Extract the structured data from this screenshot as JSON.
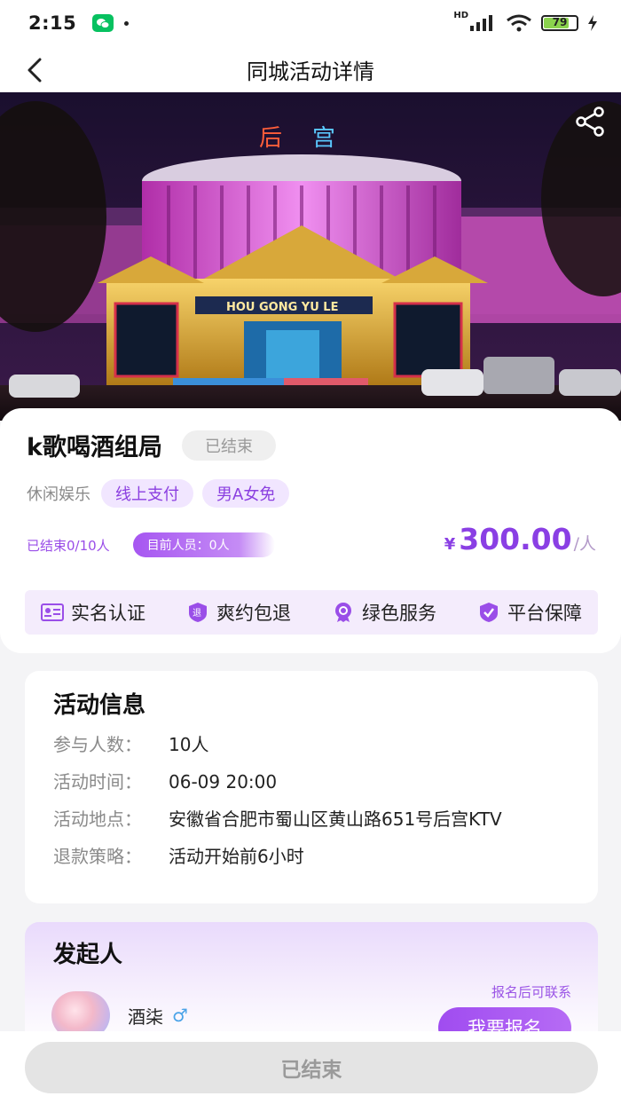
{
  "status_bar": {
    "time": "2:15",
    "battery": "79",
    "battery_level": 0.79,
    "network": "HD"
  },
  "nav": {
    "title": "同城活动详情"
  },
  "hero": {
    "sign_text": "后 宫",
    "banner_text": "HOU GONG YU LE"
  },
  "activity": {
    "title": "k歌喝酒组局",
    "status": "已结束",
    "category": "休闲娱乐",
    "tags": [
      "线上支付",
      "男A女免"
    ],
    "ended_count": "已结束0/10人",
    "current_members": "目前人员：0人",
    "price_symbol": "¥",
    "price": "300.00",
    "price_unit": "/人"
  },
  "guarantees": [
    {
      "label": "实名认证",
      "icon": "id-card-icon"
    },
    {
      "label": "爽约包退",
      "icon": "refund-icon"
    },
    {
      "label": "绿色服务",
      "icon": "badge-icon"
    },
    {
      "label": "平台保障",
      "icon": "shield-icon"
    }
  ],
  "activity_info": {
    "title": "活动信息",
    "rows": [
      {
        "label": "参与人数：",
        "value": "10人"
      },
      {
        "label": "活动时间：",
        "value": "06-09 20:00"
      },
      {
        "label": "活动地点：",
        "value": "安徽省合肥市蜀山区黄山路651号后宫KTV"
      },
      {
        "label": "退款策略：",
        "value": "活动开始前6小时"
      }
    ]
  },
  "organizer": {
    "title": "发起人",
    "name": "酒柒",
    "gender_symbol": "♂",
    "contact_hint": "报名后可联系",
    "join_label": "我要报名"
  },
  "bottom": {
    "button_label": "已结束"
  },
  "colors": {
    "accent": "#9a4ee8",
    "tag_bg": "#f1e6ff",
    "guarantee_bg": "#f4ecfc"
  }
}
